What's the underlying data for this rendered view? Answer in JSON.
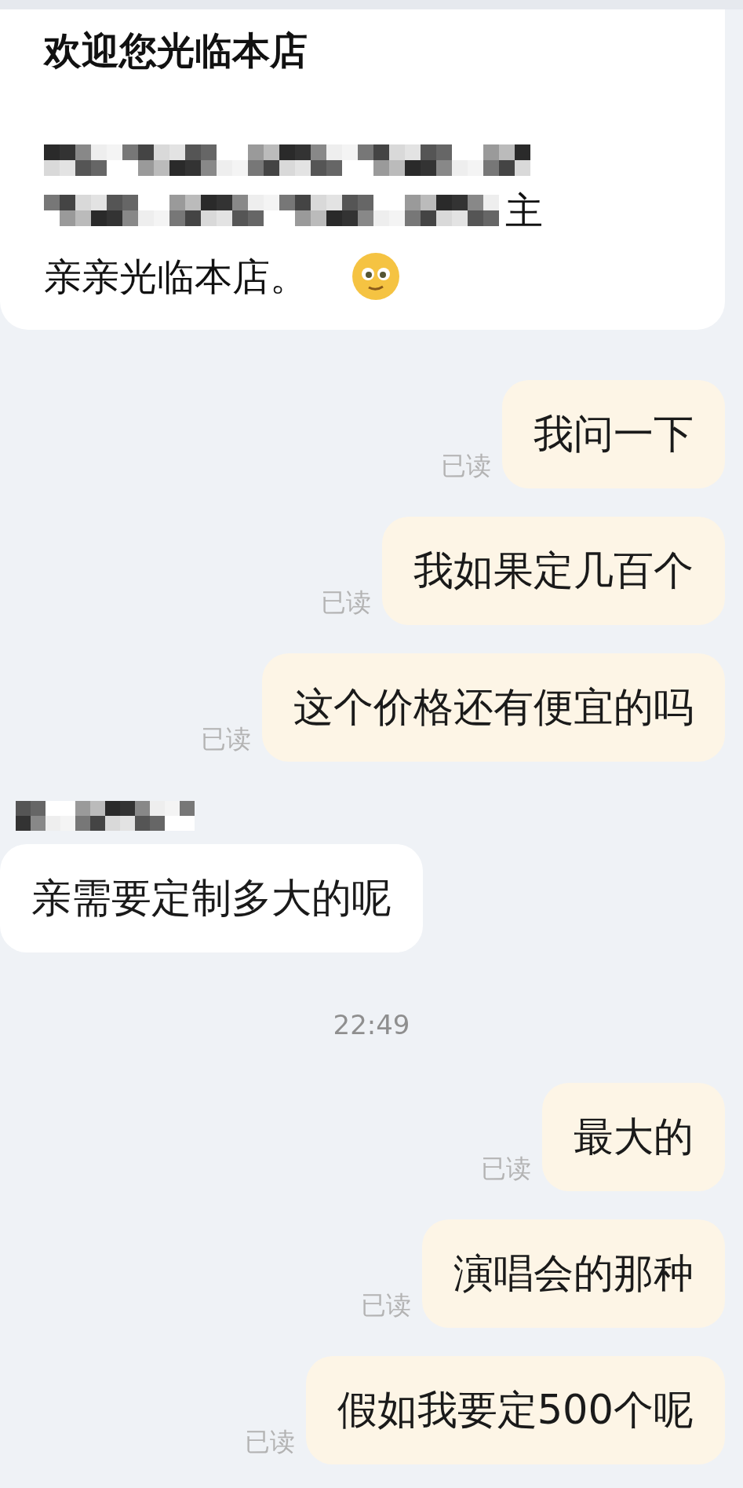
{
  "welcome_card": {
    "title": "欢迎您光临本店",
    "line_2_tail": "主",
    "line_3": "亲亲光临本店。"
  },
  "messages": [
    {
      "kind": "sent",
      "text": "我问一下",
      "status": "已读"
    },
    {
      "kind": "sent",
      "text": "我如果定几百个",
      "status": "已读"
    },
    {
      "kind": "sent",
      "text": "这个价格还有便宜的吗",
      "status": "已读"
    },
    {
      "kind": "received",
      "text": "亲需要定制多大的呢"
    },
    {
      "kind": "time",
      "text": "22:49"
    },
    {
      "kind": "sent",
      "text": "最大的",
      "status": "已读"
    },
    {
      "kind": "sent",
      "text": "演唱会的那种",
      "status": "已读"
    },
    {
      "kind": "sent",
      "text": "假如我要定500个呢",
      "status": "已读"
    }
  ]
}
